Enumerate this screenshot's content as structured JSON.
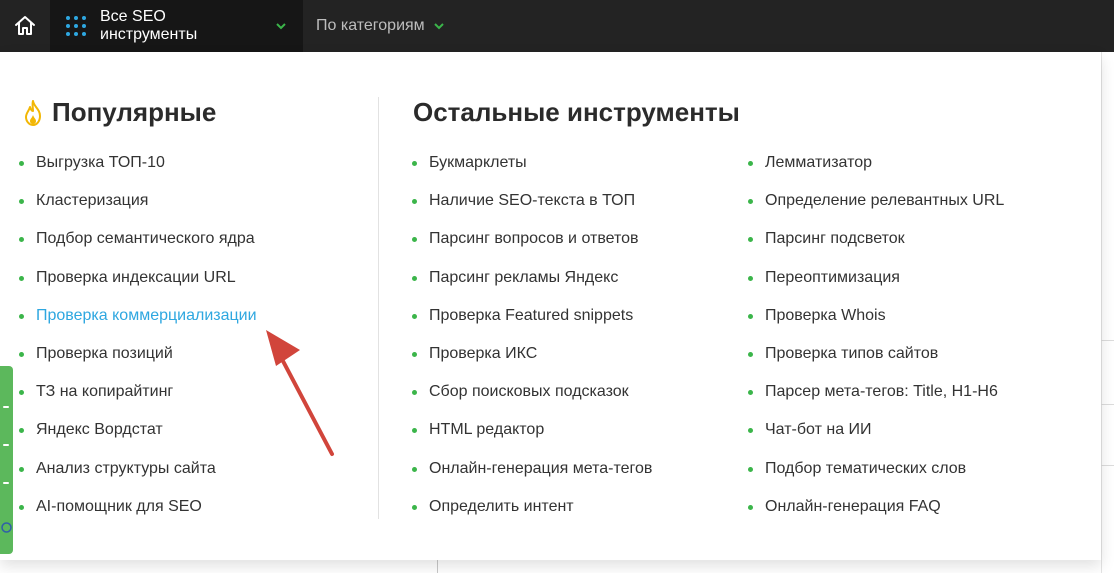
{
  "nav": {
    "home_icon": "home-icon",
    "all_tools_label": "Все SEO инструменты",
    "by_category_label": "По категориям",
    "accent_color": "#2ea7e0",
    "chevron_color": "#3bb54a"
  },
  "popular": {
    "title": "Популярные",
    "icon": "fire-icon",
    "items": [
      {
        "label": "Выгрузка ТОП-10"
      },
      {
        "label": "Кластеризация"
      },
      {
        "label": "Подбор семантического ядра"
      },
      {
        "label": "Проверка индексации URL"
      },
      {
        "label": "Проверка коммерциализации"
      },
      {
        "label": "Проверка позиций"
      },
      {
        "label": "ТЗ на копирайтинг"
      },
      {
        "label": "Яндекс Вордстат"
      },
      {
        "label": "Анализ структуры сайта"
      },
      {
        "label": "AI-помощник для SEO"
      }
    ]
  },
  "others": {
    "title": "Остальные инструменты",
    "column1": [
      {
        "label": "Букмарклеты"
      },
      {
        "label": "Наличие SEO-текста в ТОП"
      },
      {
        "label": "Парсинг вопросов и ответов"
      },
      {
        "label": "Парсинг рекламы Яндекс"
      },
      {
        "label": "Проверка Featured snippets"
      },
      {
        "label": "Проверка ИКС"
      },
      {
        "label": "Сбор поисковых подсказок"
      },
      {
        "label": "HTML редактор"
      },
      {
        "label": "Онлайн-генерация мета-тегов"
      },
      {
        "label": "Определить интент"
      }
    ],
    "column2": [
      {
        "label": "Лемматизатор"
      },
      {
        "label": "Определение релевантных URL"
      },
      {
        "label": "Парсинг подсветок"
      },
      {
        "label": "Переоптимизация"
      },
      {
        "label": "Проверка Whois"
      },
      {
        "label": "Проверка типов сайтов"
      },
      {
        "label": "Парсер мета-тегов: Title, H1-H6"
      },
      {
        "label": "Чат-бот на ИИ"
      },
      {
        "label": "Подбор тематических слов"
      },
      {
        "label": "Онлайн-генерация FAQ"
      }
    ]
  },
  "colors": {
    "bullet": "#3bb54a",
    "highlight_link": "#2ea7e0",
    "annotation_arrow": "#d1453b"
  }
}
